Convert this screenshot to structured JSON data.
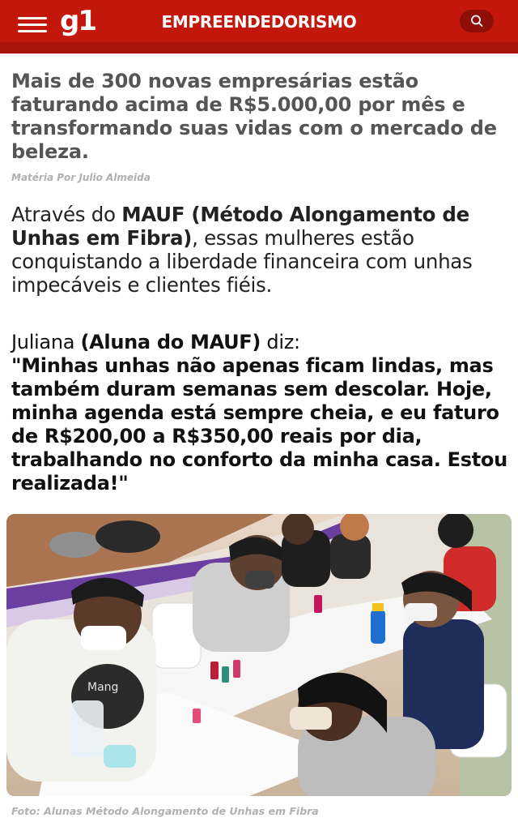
{
  "header": {
    "logo": "g1",
    "section": "EMPREENDEDORISMO",
    "menu_icon": "hamburger-menu-icon",
    "search_icon": "search-icon",
    "brand_color": "#c4170c"
  },
  "article": {
    "headline": "Mais de 300 novas empresárias estão faturando acima de R$5.000,00 por mês e transformando suas vidas com o mercado de beleza.",
    "byline": "Matéria Por Julio Almeida",
    "lead": {
      "prefix": "Através do ",
      "highlight": "MAUF (Método Alongamento de Unhas em Fibra)",
      "suffix": ", essas mulheres estão conquistando a liberdade financeira com unhas impecáveis e clientes fiéis."
    },
    "testimonial": {
      "name": "Juliana ",
      "role": "(Aluna do MAUF)",
      "verb": " diz:",
      "quote": "\"Minhas unhas não apenas ficam lindas, mas também duram semanas sem descolar. Hoje, minha agenda está sempre cheia, e eu faturo de R$200,00 a R$350,00 reais por dia, trabalhando no conforto da minha casa. Estou realizada!\""
    },
    "photo": {
      "apron_text": "Mang"
    },
    "caption": "Foto: Alunas Método Alongamento de Unhas em Fibra"
  }
}
